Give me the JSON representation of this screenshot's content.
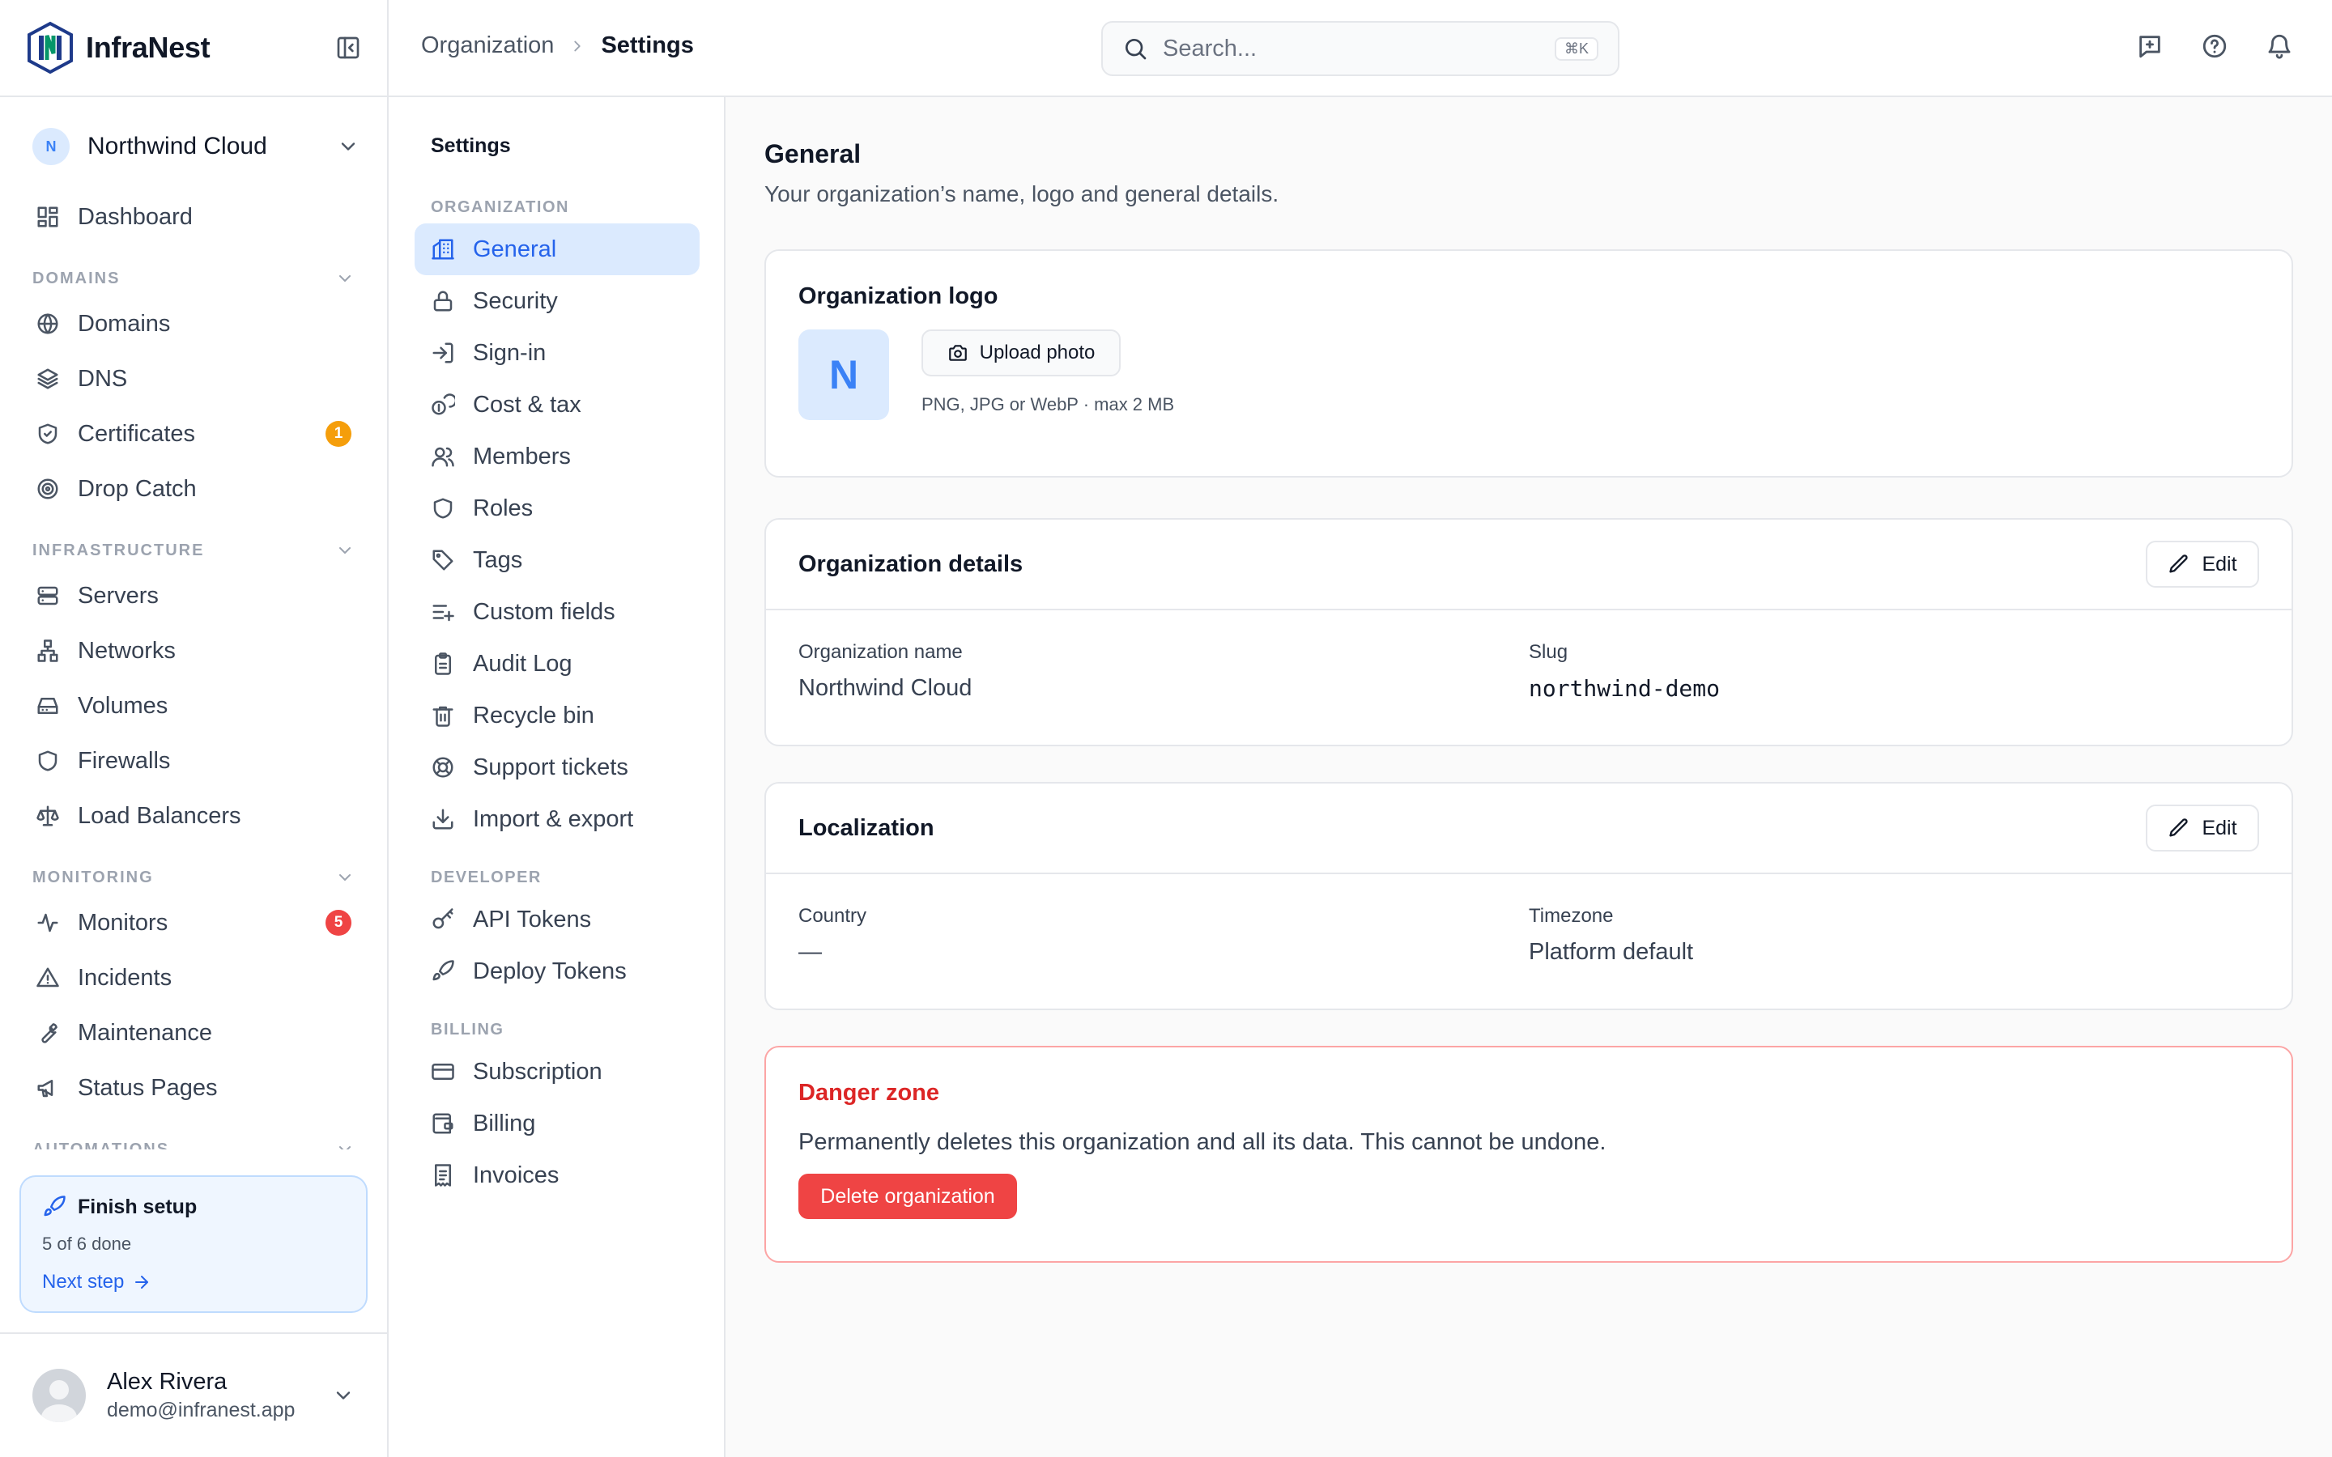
{
  "brand": {
    "name": "InfraNest"
  },
  "org_switcher": {
    "initial": "N",
    "name": "Northwind Cloud"
  },
  "sidebar": {
    "top_item": {
      "label": "Dashboard",
      "icon": "dashboard-icon"
    },
    "sections": [
      {
        "title": "DOMAINS",
        "items": [
          {
            "label": "Domains",
            "icon": "globe-icon"
          },
          {
            "label": "DNS",
            "icon": "layers-icon"
          },
          {
            "label": "Certificates",
            "icon": "shield-check-icon",
            "badge": "1",
            "badge_color": "#f59e0b"
          },
          {
            "label": "Drop Catch",
            "icon": "target-icon"
          }
        ]
      },
      {
        "title": "INFRASTRUCTURE",
        "items": [
          {
            "label": "Servers",
            "icon": "server-icon"
          },
          {
            "label": "Networks",
            "icon": "network-icon"
          },
          {
            "label": "Volumes",
            "icon": "hard-drive-icon"
          },
          {
            "label": "Firewalls",
            "icon": "shield-icon"
          },
          {
            "label": "Load Balancers",
            "icon": "scale-icon"
          }
        ]
      },
      {
        "title": "MONITORING",
        "items": [
          {
            "label": "Monitors",
            "icon": "activity-icon",
            "badge": "5",
            "badge_color": "#ef4444"
          },
          {
            "label": "Incidents",
            "icon": "alert-triangle-icon"
          },
          {
            "label": "Maintenance",
            "icon": "wrench-icon"
          },
          {
            "label": "Status Pages",
            "icon": "megaphone-icon"
          }
        ]
      },
      {
        "title": "AUTOMATIONS",
        "items": []
      }
    ]
  },
  "setup": {
    "title": "Finish setup",
    "progress": "5 of 6 done",
    "next": "Next step"
  },
  "user": {
    "name": "Alex Rivera",
    "email": "demo@infranest.app"
  },
  "topbar": {
    "breadcrumb": [
      "Organization",
      "Settings"
    ],
    "search_placeholder": "Search...",
    "search_shortcut": "⌘K"
  },
  "subnav": {
    "title": "Settings",
    "sections": [
      {
        "title": "ORGANIZATION",
        "items": [
          {
            "label": "General",
            "icon": "building-icon",
            "active": true
          },
          {
            "label": "Security",
            "icon": "lock-icon"
          },
          {
            "label": "Sign-in",
            "icon": "log-in-icon"
          },
          {
            "label": "Cost & tax",
            "icon": "coins-icon"
          },
          {
            "label": "Members",
            "icon": "users-icon"
          },
          {
            "label": "Roles",
            "icon": "shield-icon"
          },
          {
            "label": "Tags",
            "icon": "tag-icon"
          },
          {
            "label": "Custom fields",
            "icon": "list-plus-icon"
          },
          {
            "label": "Audit Log",
            "icon": "clipboard-icon"
          },
          {
            "label": "Recycle bin",
            "icon": "trash-icon"
          },
          {
            "label": "Support tickets",
            "icon": "life-buoy-icon"
          },
          {
            "label": "Import & export",
            "icon": "download-icon"
          }
        ]
      },
      {
        "title": "DEVELOPER",
        "items": [
          {
            "label": "API Tokens",
            "icon": "key-icon"
          },
          {
            "label": "Deploy Tokens",
            "icon": "rocket-icon"
          }
        ]
      },
      {
        "title": "BILLING",
        "items": [
          {
            "label": "Subscription",
            "icon": "credit-card-icon"
          },
          {
            "label": "Billing",
            "icon": "wallet-icon"
          },
          {
            "label": "Invoices",
            "icon": "receipt-icon"
          }
        ]
      }
    ]
  },
  "page": {
    "title": "General",
    "subtitle": "Your organization’s name, logo and general details."
  },
  "logo_card": {
    "title": "Organization logo",
    "initial": "N",
    "upload_label": "Upload photo",
    "hint": "PNG, JPG or WebP · max 2 MB"
  },
  "details_card": {
    "title": "Organization details",
    "edit_label": "Edit",
    "name_label": "Organization name",
    "name_value": "Northwind Cloud",
    "slug_label": "Slug",
    "slug_value": "northwind-demo"
  },
  "localization_card": {
    "title": "Localization",
    "edit_label": "Edit",
    "country_label": "Country",
    "country_value": "—",
    "timezone_label": "Timezone",
    "timezone_value": "Platform default"
  },
  "danger_card": {
    "title": "Danger zone",
    "description": "Permanently deletes this organization and all its data. This cannot be undone.",
    "button_label": "Delete organization"
  },
  "colors": {
    "accent": "#2563eb",
    "accent_soft": "#dbeafe",
    "danger": "#ef4444",
    "warning": "#f59e0b"
  }
}
